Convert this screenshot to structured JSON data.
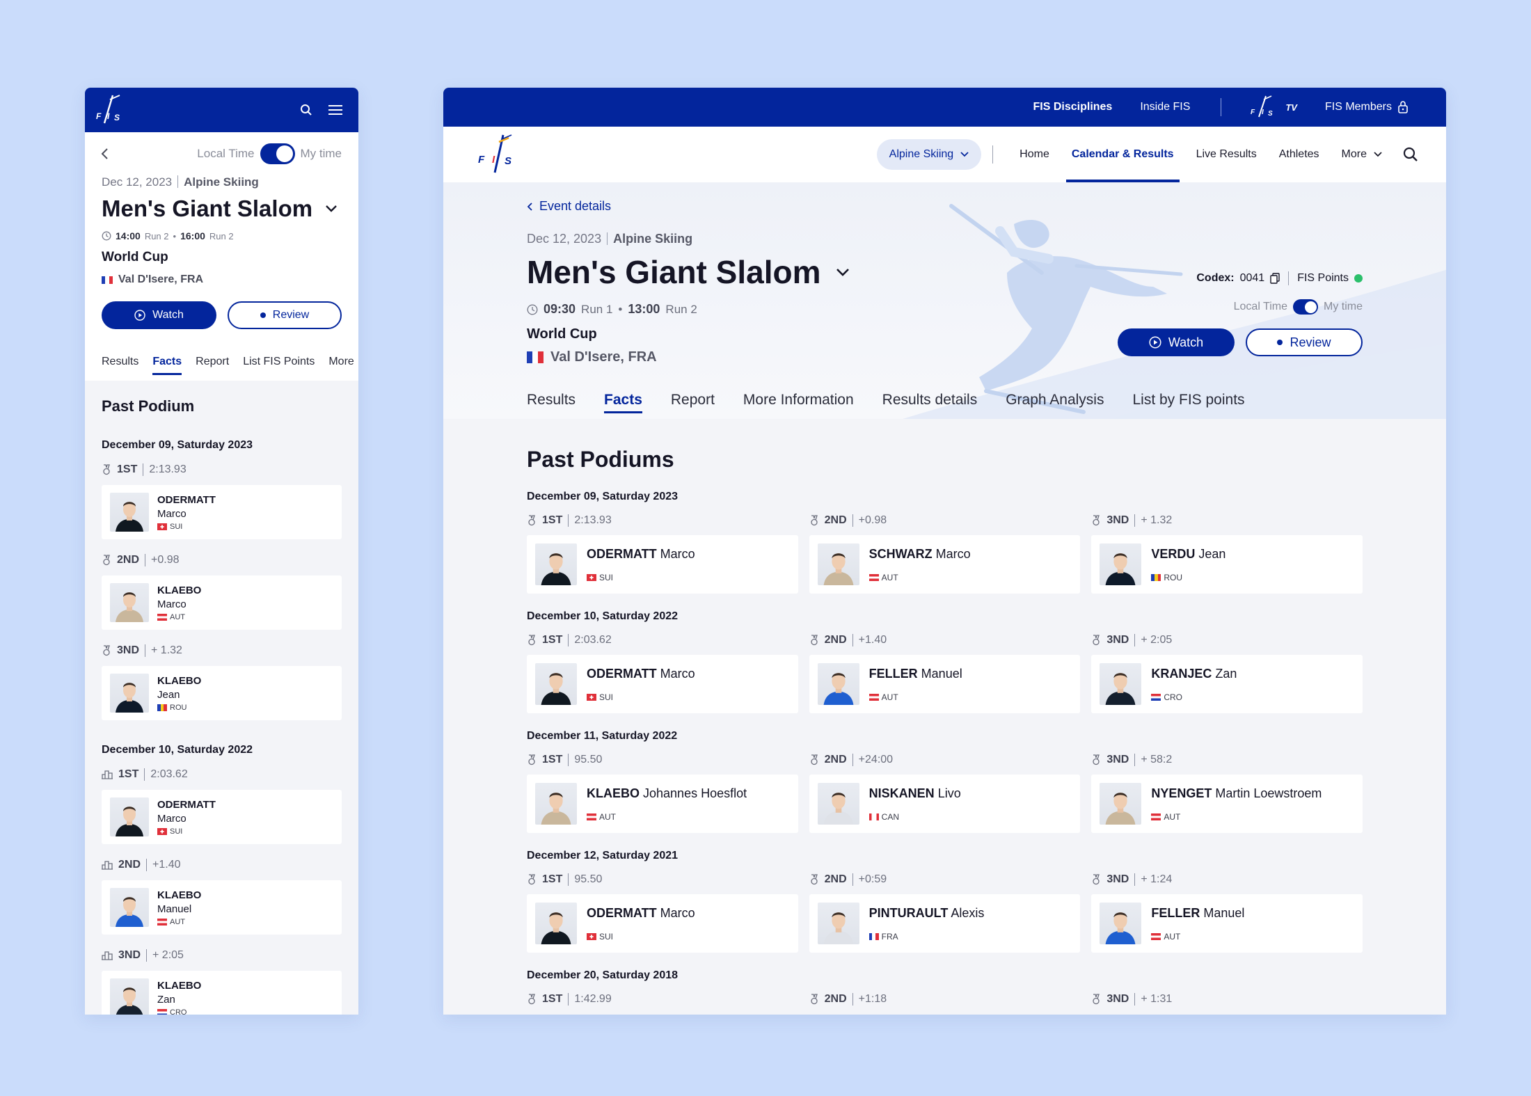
{
  "logo": "FIS",
  "mobile": {
    "local_time": "Local Time",
    "my_time": "My time",
    "date": "Dec 12, 2023",
    "discipline": "Alpine Skiing",
    "title": "Men's Giant Slalom",
    "run1_time": "14:00",
    "run1_label": "Run 2",
    "run2_time": "16:00",
    "run2_label": "Run 2",
    "cup": "World Cup",
    "location": "Val D'Isere, FRA",
    "watch": "Watch",
    "review": "Review",
    "tabs": [
      "Results",
      "Facts",
      "Report",
      "List FIS Points",
      "More"
    ],
    "section": "Past Podium",
    "groups": [
      {
        "date": "December 09, Saturday 2023",
        "icon": "medal-icon",
        "entries": [
          {
            "place": "1ST",
            "time": "2:13.93",
            "last": "ODERMATT",
            "first": "Marco",
            "nat": "SUI"
          },
          {
            "place": "2ND",
            "time": "+0.98",
            "last": "KLAEBO",
            "first": "Marco",
            "nat": "AUT"
          },
          {
            "place": "3ND",
            "time": "+ 1.32",
            "last": "KLAEBO",
            "first": "Jean",
            "nat": "ROU"
          }
        ]
      },
      {
        "date": "December 10, Saturday 2022",
        "icon": "podium-icon",
        "entries": [
          {
            "place": "1ST",
            "time": "2:03.62",
            "last": "ODERMATT",
            "first": "Marco",
            "nat": "SUI"
          },
          {
            "place": "2ND",
            "time": "+1.40",
            "last": "KLAEBO",
            "first": "Manuel",
            "nat": "AUT"
          },
          {
            "place": "3ND",
            "time": "+ 2:05",
            "last": "KLAEBO",
            "first": "Zan",
            "nat": "CRO"
          }
        ]
      }
    ]
  },
  "desktop": {
    "top_links": [
      "FIS Disciplines",
      "Inside FIS",
      "FIS Members"
    ],
    "fis_tv": "TV",
    "discipline_select": "Alpine Skiing",
    "nav": [
      "Home",
      "Calendar & Results",
      "Live Results",
      "Athletes",
      "More"
    ],
    "back": "Event details",
    "date": "Dec 12, 2023",
    "discipline": "Alpine Skiing",
    "title": "Men's Giant Slalom",
    "run1_time": "09:30",
    "run1_label": "Run 1",
    "run2_time": "13:00",
    "run2_label": "Run 2",
    "cup": "World Cup",
    "location": "Val D'Isere, FRA",
    "codex_label": "Codex:",
    "codex_value": "0041",
    "fis_points": "FIS Points",
    "local_time": "Local Time",
    "my_time": "My time",
    "watch": "Watch",
    "review": "Review",
    "tabs": [
      "Results",
      "Facts",
      "Report",
      "More Information",
      "Results details",
      "Graph Analysis",
      "List by FIS points"
    ],
    "section": "Past Podiums",
    "groups": [
      {
        "date": "December 09, Saturday 2023",
        "entries": [
          {
            "place": "1ST",
            "time": "2:13.93",
            "last": "ODERMATT",
            "first": "Marco",
            "nat": "SUI"
          },
          {
            "place": "2ND",
            "time": "+0.98",
            "last": "SCHWARZ",
            "first": "Marco",
            "nat": "AUT"
          },
          {
            "place": "3ND",
            "time": "+ 1.32",
            "last": "VERDU",
            "first": "Jean",
            "nat": "ROU"
          }
        ]
      },
      {
        "date": "December 10, Saturday 2022",
        "entries": [
          {
            "place": "1ST",
            "time": "2:03.62",
            "last": "ODERMATT",
            "first": "Marco",
            "nat": "SUI"
          },
          {
            "place": "2ND",
            "time": "+1.40",
            "last": "FELLER",
            "first": "Manuel",
            "nat": "AUT"
          },
          {
            "place": "3ND",
            "time": "+ 2:05",
            "last": "KRANJEC",
            "first": "Zan",
            "nat": "CRO"
          }
        ]
      },
      {
        "date": "December 11, Saturday 2022",
        "entries": [
          {
            "place": "1ST",
            "time": "95.50",
            "last": "KLAEBO",
            "first": "Johannes Hoesflot",
            "nat": "AUT"
          },
          {
            "place": "2ND",
            "time": "+24:00",
            "last": "NISKANEN",
            "first": "Livo",
            "nat": "CAN"
          },
          {
            "place": "3ND",
            "time": "+ 58:2",
            "last": "NYENGET",
            "first": "Martin Loewstroem",
            "nat": "AUT"
          }
        ]
      },
      {
        "date": "December 12, Saturday 2021",
        "entries": [
          {
            "place": "1ST",
            "time": "95.50",
            "last": "ODERMATT",
            "first": "Marco",
            "nat": "SUI"
          },
          {
            "place": "2ND",
            "time": "+0:59",
            "last": "PINTURAULT",
            "first": "Alexis",
            "nat": "FRA"
          },
          {
            "place": "3ND",
            "time": "+ 1:24",
            "last": "FELLER",
            "first": "Manuel",
            "nat": "AUT"
          }
        ]
      },
      {
        "date": "December 20, Saturday 2018",
        "entries": [
          {
            "place": "1ST",
            "time": "1:42.99"
          },
          {
            "place": "2ND",
            "time": "+1:18"
          },
          {
            "place": "3ND",
            "time": "+ 1:31"
          }
        ]
      }
    ]
  },
  "colors": {
    "navy": "#03259c",
    "background": "#cadcfb",
    "fis_points_ok": "#2bbf6b"
  }
}
